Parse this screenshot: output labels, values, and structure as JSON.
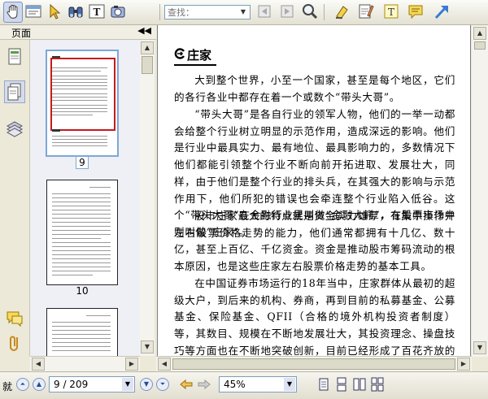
{
  "search": {
    "placeholder": "查找："
  },
  "left_pane": {
    "title": "页面",
    "collapse_glyph": "◀◀",
    "side_icons": [
      "page-icon",
      "thumbnails-icon",
      "layers-icon",
      "comments-icon",
      "attachment-icon"
    ],
    "thumbnails": [
      {
        "label": "9",
        "selected": true
      },
      {
        "label": "10",
        "selected": false
      },
      {
        "label": "",
        "selected": false
      }
    ]
  },
  "document": {
    "section_title": "庄家",
    "paragraphs": [
      "大到整个世界，小至一个国家，甚至是每个地区，它们的各行各业中都存在着一个或数个“带头大哥”。",
      "“带头大哥”是各自行业的领军人物，他们的一举一动都会给整个行业树立明显的示范作用，造成深远的影响。他们是行业中最具实力、最有地位、最具影响力的，多数情况下他们都能引领整个行业不断向前开拓进取、发展壮大，同样，由于他们是整个行业的排头兵，在其强大的影响与示范作用下，他们所犯的错误也会牵连整个行业陷入低谷。这个“带头大哥”在金融行业里叫做“金融大鳄”，在股票市场中则叫做“庄家”。",
      "股市庄家最大的特点就是资金实力雄厚，有集中操作并左右股票价格走势的能力，他们通常都拥有十几亿、数十亿，甚至上百亿、千亿资金。资金是推动股市筹码流动的根本原因，也是这些庄家左右股票价格走势的基本工具。",
      "在中国证券市场运行的18年当中，庄家群体从最初的超级大户，到后来的机构、券商，再到目前的私募基金、公募基金、保险基金、QFII（合格的境外机构投资者制度）等，其数目、规模在不断地发展壮大，其投资理念、操盘技巧等方面也在不断地突破创新，目前已经形成了百花齐放的局面。"
    ]
  },
  "status_bar": {
    "label": "就",
    "page": "9 / 209",
    "zoom": "45%"
  },
  "colors": {
    "selection_border": "#7fa7d8",
    "red_box": "#c81a1a",
    "doc_background": "#7a7d86"
  }
}
